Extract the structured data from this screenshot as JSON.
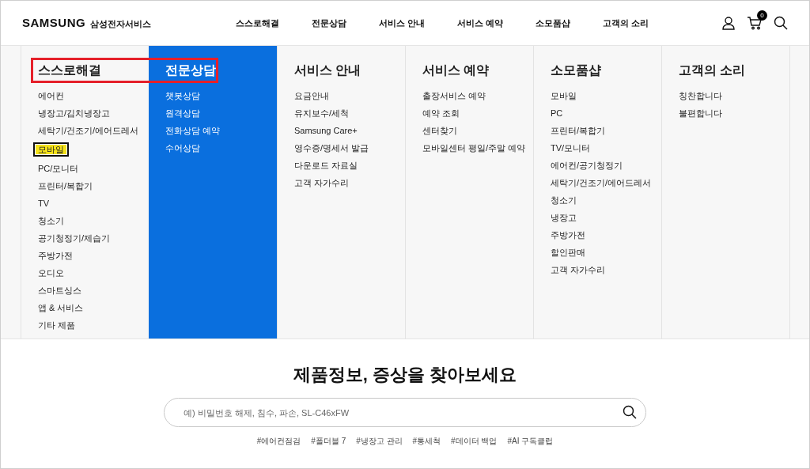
{
  "header": {
    "logo": "SAMSUNG",
    "service_name": "삼성전자서비스",
    "nav": [
      {
        "label": "스스로해결"
      },
      {
        "label": "전문상담"
      },
      {
        "label": "서비스 안내"
      },
      {
        "label": "서비스 예약"
      },
      {
        "label": "소모품샵"
      },
      {
        "label": "고객의 소리"
      }
    ],
    "cart_count": "0"
  },
  "mega_menu": {
    "annotation_box": {
      "color": "#e5202a"
    },
    "columns": [
      {
        "heading": "스스로해결",
        "selected": false,
        "items": [
          {
            "label": "에어컨",
            "highlighted": false
          },
          {
            "label": "냉장고/김치냉장고",
            "highlighted": false
          },
          {
            "label": "세탁기/건조기/에어드레서",
            "highlighted": false
          },
          {
            "label": "모바일",
            "highlighted": true
          },
          {
            "label": "PC/모니터",
            "highlighted": false
          },
          {
            "label": "프린터/복합기",
            "highlighted": false
          },
          {
            "label": "TV",
            "highlighted": false
          },
          {
            "label": "청소기",
            "highlighted": false
          },
          {
            "label": "공기청정기/제습기",
            "highlighted": false
          },
          {
            "label": "주방가전",
            "highlighted": false
          },
          {
            "label": "오디오",
            "highlighted": false
          },
          {
            "label": "스마트싱스",
            "highlighted": false
          },
          {
            "label": "앱 & 서비스",
            "highlighted": false
          },
          {
            "label": "기타 제품",
            "highlighted": false
          }
        ]
      },
      {
        "heading": "전문상담",
        "selected": true,
        "items": [
          {
            "label": "챗봇상담",
            "highlighted": false
          },
          {
            "label": "원격상담",
            "highlighted": false
          },
          {
            "label": "전화상담 예약",
            "highlighted": false
          },
          {
            "label": "수어상담",
            "highlighted": false
          }
        ]
      },
      {
        "heading": "서비스 안내",
        "selected": false,
        "items": [
          {
            "label": "요금안내",
            "highlighted": false
          },
          {
            "label": "유지보수/세척",
            "highlighted": false
          },
          {
            "label": "Samsung Care+",
            "highlighted": false
          },
          {
            "label": "영수증/명세서 발급",
            "highlighted": false
          },
          {
            "label": "다운로드 자료실",
            "highlighted": false
          },
          {
            "label": "고객 자가수리",
            "highlighted": false
          }
        ]
      },
      {
        "heading": "서비스 예약",
        "selected": false,
        "items": [
          {
            "label": "출장서비스 예약",
            "highlighted": false
          },
          {
            "label": "예약 조회",
            "highlighted": false
          },
          {
            "label": "센터찾기",
            "highlighted": false
          },
          {
            "label": "모바일센터 평일/주말 예약",
            "highlighted": false
          }
        ]
      },
      {
        "heading": "소모품샵",
        "selected": false,
        "items": [
          {
            "label": "모바일",
            "highlighted": false
          },
          {
            "label": "PC",
            "highlighted": false
          },
          {
            "label": "프린터/복합기",
            "highlighted": false
          },
          {
            "label": "TV/모니터",
            "highlighted": false
          },
          {
            "label": "에어컨/공기청정기",
            "highlighted": false
          },
          {
            "label": "세탁기/건조기/에어드레서",
            "highlighted": false
          },
          {
            "label": "청소기",
            "highlighted": false
          },
          {
            "label": "냉장고",
            "highlighted": false
          },
          {
            "label": "주방가전",
            "highlighted": false
          },
          {
            "label": "할인판매",
            "highlighted": false
          },
          {
            "label": "고객 자가수리",
            "highlighted": false
          }
        ]
      },
      {
        "heading": "고객의 소리",
        "selected": false,
        "items": [
          {
            "label": "칭찬합니다",
            "highlighted": false
          },
          {
            "label": "불편합니다",
            "highlighted": false
          }
        ]
      }
    ]
  },
  "search": {
    "title": "제품정보, 증상을 찾아보세요",
    "placeholder": "예) 비밀번호 해제, 침수, 파손, SL-C46xFW",
    "tags": [
      "#에어컨점검",
      "#폴더블 7",
      "#냉장고 관리",
      "#통세척",
      "#데이터 백업",
      "#AI 구독클럽"
    ]
  }
}
